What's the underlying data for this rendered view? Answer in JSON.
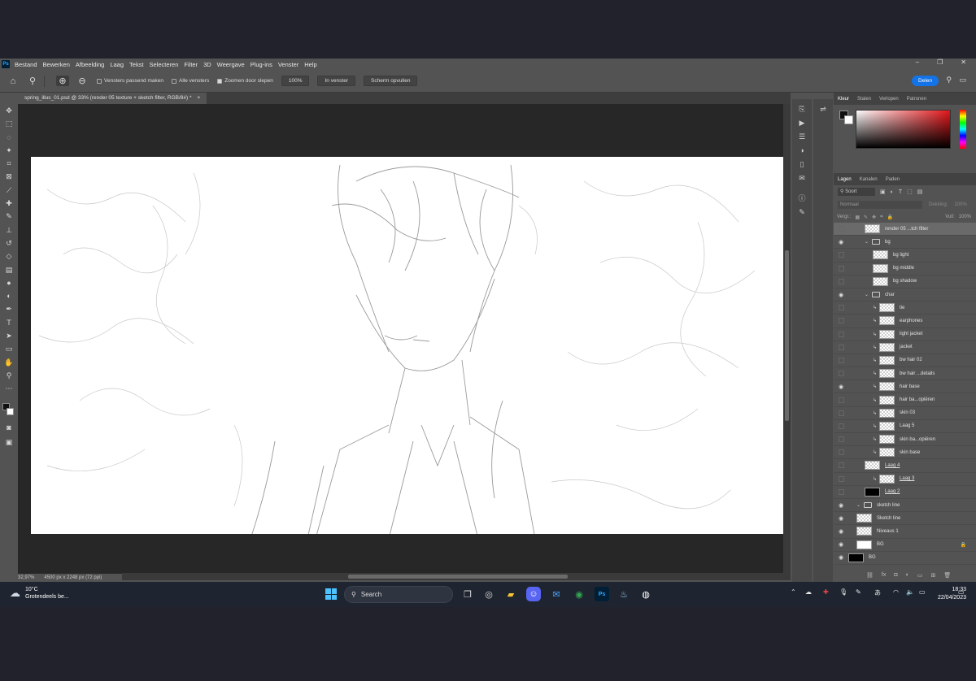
{
  "menubar": {
    "app_icon": "Ps",
    "items": [
      "Bestand",
      "Bewerken",
      "Afbeelding",
      "Laag",
      "Tekst",
      "Selecteren",
      "Filter",
      "3D",
      "Weergave",
      "Plug-ins",
      "Venster",
      "Help"
    ],
    "window_controls": [
      "–",
      "❐",
      "✕"
    ]
  },
  "options": {
    "resize_windows": "Vensters passend maken",
    "all_windows": "Alle vensters",
    "scrubby_zoom": "Zoomen door slepen",
    "zoom_100": "100%",
    "fit_screen": "In venster",
    "fill_screen": "Scherm opvullen",
    "share": "Delen"
  },
  "document": {
    "tab_title": "spring_illus_01.psd @ 33% (render 05 texture + sketch filter, RGB/8#) *",
    "zoom": "32,97%",
    "info": "4500 px x 2248 px (72 ppi)"
  },
  "color_panel": {
    "tabs": [
      "Kleur",
      "Stalen",
      "Verlopen",
      "Patronen"
    ]
  },
  "layers_panel": {
    "tabs": [
      "Lagen",
      "Kanalen",
      "Paden"
    ],
    "filter_kind": "Soort",
    "blend_mode": "Normaal",
    "opacity_label": "Dekking:",
    "opacity_value": "100%",
    "lock_label": "Vergr.:",
    "fill_label": "Vull:",
    "fill_value": "100%",
    "layers": [
      {
        "name": "render 05 ...tch filter",
        "visible": false,
        "indent": 2,
        "kind": "layer",
        "selected": true
      },
      {
        "name": "bg",
        "visible": true,
        "indent": 2,
        "kind": "group"
      },
      {
        "name": "bg light",
        "visible": false,
        "indent": 3,
        "kind": "layer"
      },
      {
        "name": "bg middle",
        "visible": false,
        "indent": 3,
        "kind": "layer"
      },
      {
        "name": "bg shadow",
        "visible": false,
        "indent": 3,
        "kind": "layer"
      },
      {
        "name": "char",
        "visible": true,
        "indent": 2,
        "kind": "group"
      },
      {
        "name": "tie",
        "visible": false,
        "indent": 3,
        "kind": "layer",
        "clip": true
      },
      {
        "name": "earphones",
        "visible": false,
        "indent": 3,
        "kind": "layer",
        "clip": true
      },
      {
        "name": "light jacket",
        "visible": false,
        "indent": 3,
        "kind": "layer",
        "clip": true
      },
      {
        "name": "jacket",
        "visible": false,
        "indent": 3,
        "kind": "layer",
        "clip": true
      },
      {
        "name": "bw hair 02",
        "visible": false,
        "indent": 3,
        "kind": "layer",
        "clip": true
      },
      {
        "name": "bw hair ...details",
        "visible": false,
        "indent": 3,
        "kind": "layer",
        "clip": true
      },
      {
        "name": "hair base",
        "visible": true,
        "indent": 3,
        "kind": "layer",
        "clip": true
      },
      {
        "name": "hair ba...opiëren",
        "visible": false,
        "indent": 3,
        "kind": "layer",
        "clip": true
      },
      {
        "name": "skin 03",
        "visible": false,
        "indent": 3,
        "kind": "layer",
        "clip": true
      },
      {
        "name": "Laag 5",
        "visible": false,
        "indent": 3,
        "kind": "layer",
        "clip": true
      },
      {
        "name": "skin ba...opiëren",
        "visible": false,
        "indent": 3,
        "kind": "layer",
        "clip": true
      },
      {
        "name": "skin base",
        "visible": false,
        "indent": 3,
        "kind": "layer",
        "clip": true
      },
      {
        "name": "Laag 4",
        "visible": false,
        "indent": 2,
        "kind": "layer",
        "underline": true
      },
      {
        "name": "Laag 3",
        "visible": false,
        "indent": 3,
        "kind": "layer",
        "clip": true,
        "underline": true
      },
      {
        "name": "Laag 2",
        "visible": false,
        "indent": 2,
        "kind": "layer",
        "thumb": "black",
        "underline": true
      },
      {
        "name": "sketch line",
        "visible": true,
        "indent": 1,
        "kind": "group"
      },
      {
        "name": "Sketch line",
        "visible": true,
        "indent": 1,
        "kind": "layer"
      },
      {
        "name": "Niveaus 1",
        "visible": true,
        "indent": 1,
        "kind": "layer"
      },
      {
        "name": "BG",
        "visible": true,
        "indent": 1,
        "kind": "layer",
        "thumb": "white",
        "locked": true
      },
      {
        "name": "BG",
        "visible": true,
        "indent": 0,
        "kind": "layer",
        "thumb": "black"
      }
    ]
  },
  "taskbar": {
    "weather_temp": "10°C",
    "weather_desc": "Grotendeels be...",
    "search_placeholder": "Search",
    "time": "18:33",
    "date": "22/04/2023"
  }
}
